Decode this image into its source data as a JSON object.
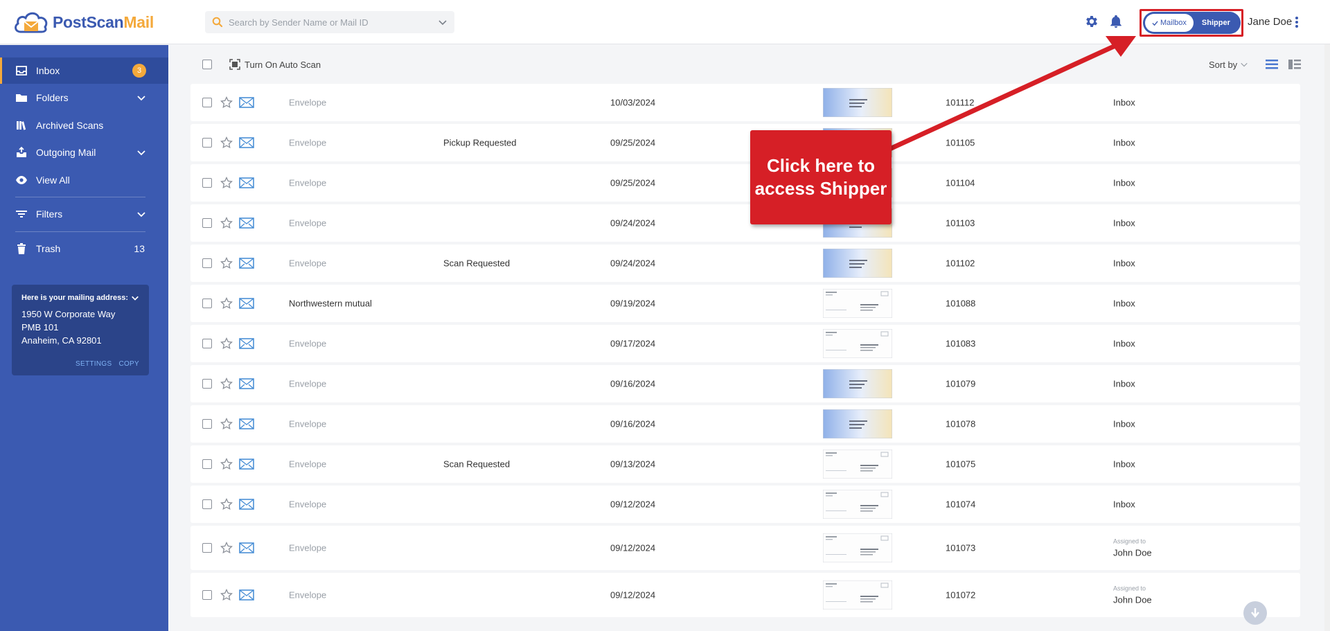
{
  "header": {
    "logo_text_main": "PostScan",
    "logo_text_accent": "Mail",
    "search_placeholder": "Search by Sender Name or Mail ID",
    "toggle_mailbox": "Mailbox",
    "toggle_shipper": "Shipper",
    "user_name": "Jane Doe"
  },
  "sidebar": {
    "items": [
      {
        "label": "Inbox",
        "badge": "3"
      },
      {
        "label": "Folders"
      },
      {
        "label": "Archived Scans"
      },
      {
        "label": "Outgoing Mail"
      },
      {
        "label": "View All"
      },
      {
        "label": "Filters"
      },
      {
        "label": "Trash",
        "count": "13"
      }
    ],
    "address": {
      "title": "Here is your mailing address:",
      "line1": "1950 W Corporate Way",
      "line2": "PMB 101",
      "line3": "Anaheim, CA 92801",
      "settings": "SETTINGS",
      "copy": "COPY"
    }
  },
  "toolbar": {
    "auto_scan": "Turn On Auto Scan",
    "sort_by": "Sort by"
  },
  "rows": [
    {
      "sender": "Envelope",
      "status": "",
      "date": "10/03/2024",
      "mail_id": "101112",
      "location": "Inbox",
      "thumb": "blue"
    },
    {
      "sender": "Envelope",
      "status": "Pickup Requested",
      "date": "09/25/2024",
      "mail_id": "101105",
      "location": "Inbox",
      "thumb": "blue"
    },
    {
      "sender": "Envelope",
      "status": "",
      "date": "09/25/2024",
      "mail_id": "101104",
      "location": "Inbox",
      "thumb": "blue"
    },
    {
      "sender": "Envelope",
      "status": "",
      "date": "09/24/2024",
      "mail_id": "101103",
      "location": "Inbox",
      "thumb": "blue"
    },
    {
      "sender": "Envelope",
      "status": "Scan Requested",
      "date": "09/24/2024",
      "mail_id": "101102",
      "location": "Inbox",
      "thumb": "blue"
    },
    {
      "sender": "Northwestern mutual",
      "status": "",
      "date": "09/19/2024",
      "mail_id": "101088",
      "location": "Inbox",
      "thumb": "white"
    },
    {
      "sender": "Envelope",
      "status": "",
      "date": "09/17/2024",
      "mail_id": "101083",
      "location": "Inbox",
      "thumb": "white"
    },
    {
      "sender": "Envelope",
      "status": "",
      "date": "09/16/2024",
      "mail_id": "101079",
      "location": "Inbox",
      "thumb": "blue"
    },
    {
      "sender": "Envelope",
      "status": "",
      "date": "09/16/2024",
      "mail_id": "101078",
      "location": "Inbox",
      "thumb": "blue"
    },
    {
      "sender": "Envelope",
      "status": "Scan Requested",
      "date": "09/13/2024",
      "mail_id": "101075",
      "location": "Inbox",
      "thumb": "white"
    },
    {
      "sender": "Envelope",
      "status": "",
      "date": "09/12/2024",
      "mail_id": "101074",
      "location": "Inbox",
      "thumb": "white"
    },
    {
      "sender": "Envelope",
      "status": "",
      "date": "09/12/2024",
      "mail_id": "101073",
      "assigned_label": "Assigned to",
      "assigned_name": "John Doe",
      "thumb": "white"
    },
    {
      "sender": "Envelope",
      "status": "",
      "date": "09/12/2024",
      "mail_id": "101072",
      "assigned_label": "Assigned to",
      "assigned_name": "John Doe",
      "thumb": "white"
    }
  ],
  "callout": {
    "line1": "Click here to",
    "line2": "access Shipper"
  },
  "colors": {
    "brand_blue": "#3b5ab1",
    "accent_orange": "#f4a93b",
    "callout_red": "#d61f26"
  }
}
